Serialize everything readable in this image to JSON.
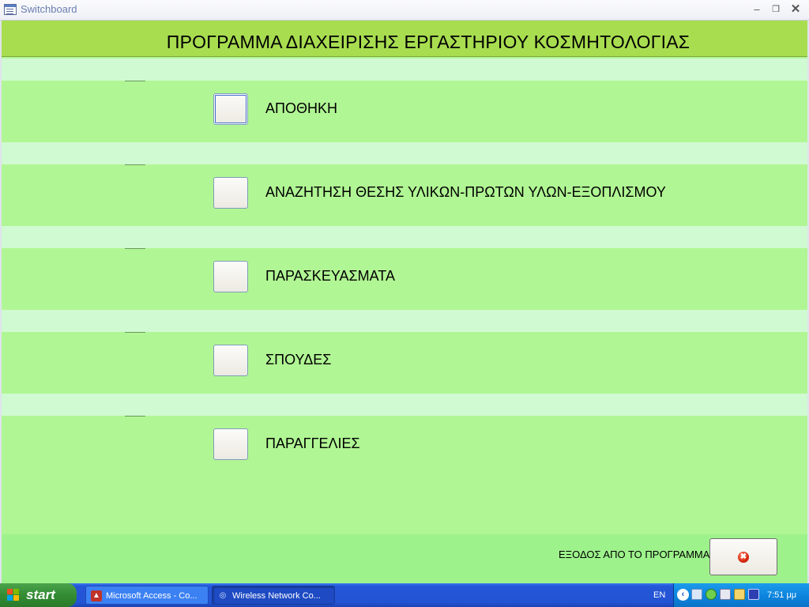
{
  "window": {
    "title": "Switchboard",
    "min_icon": "minimize-icon",
    "restore_icon": "restore-icon",
    "close_icon": "close-icon"
  },
  "form": {
    "title": "ΠΡΟΓΡΑΜΜΑ ΔΙΑΧΕΙΡΙΣΗΣ ΕΡΓΑΣΤΗΡΙΟΥ ΚΟΣΜΗΤΟΛΟΓΙΑΣ",
    "items": [
      {
        "label": "ΑΠΟΘΗΚΗ"
      },
      {
        "label": "ΑΝΑΖΗΤΗΣΗ ΘΕΣΗΣ ΥΛΙΚΩΝ-ΠΡΩΤΩΝ ΥΛΩΝ-ΕΞΟΠΛΙΣΜΟΥ"
      },
      {
        "label": "ΠΑΡΑΣΚΕΥΑΣΜΑΤΑ"
      },
      {
        "label": "ΣΠΟΥΔΕΣ"
      },
      {
        "label": "ΠΑΡΑΓΓΕΛΙΕΣ"
      }
    ],
    "exit_label": "ΕΞΟΔΟΣ ΑΠΟ ΤΟ ΠΡΟΓΡΑΜΜΑ",
    "exit_icon": "exit-x-icon"
  },
  "taskbar": {
    "start_label": "start",
    "tasks": [
      {
        "label": "Microsoft Access - Co...",
        "icon": "access-icon"
      },
      {
        "label": "Wireless Network Co...",
        "icon": "wireless-icon"
      }
    ],
    "language": "EN",
    "clock": "7:51 μμ"
  },
  "colors": {
    "header": "#a8dd50",
    "body": "#b1f694",
    "band": "#d0fad2",
    "footer": "#9ef28c"
  }
}
